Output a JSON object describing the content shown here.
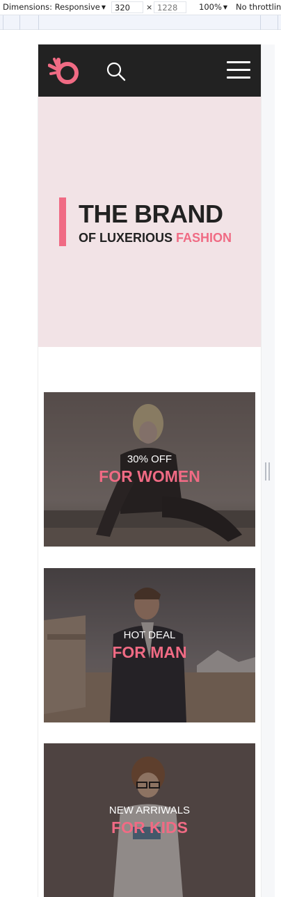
{
  "devtools": {
    "dimensions_label": "Dimensions: Responsive",
    "width_value": "320",
    "height_value": "1228",
    "times": "×",
    "zoom": "100%",
    "throttling": "No throttling"
  },
  "header": {
    "logo_icon": "brand-b-logo-icon",
    "search_icon": "search-icon",
    "menu_icon": "hamburger-menu-icon"
  },
  "hero": {
    "title": "THE BRAND",
    "subtitle_prefix": "OF LUXERIOUS",
    "subtitle_accent": "FASHION"
  },
  "banners": [
    {
      "kicker": "30% OFF",
      "headline": "FOR WOMEN"
    },
    {
      "kicker": "HOT DEAL",
      "headline": "FOR MAN"
    },
    {
      "kicker": "NEW ARRIWALS",
      "headline": "FOR KIDS"
    }
  ],
  "colors": {
    "accent": "#f06b84",
    "header_bg": "#222222",
    "hero_bg": "#f2e3e6",
    "text_dark": "#222222"
  }
}
